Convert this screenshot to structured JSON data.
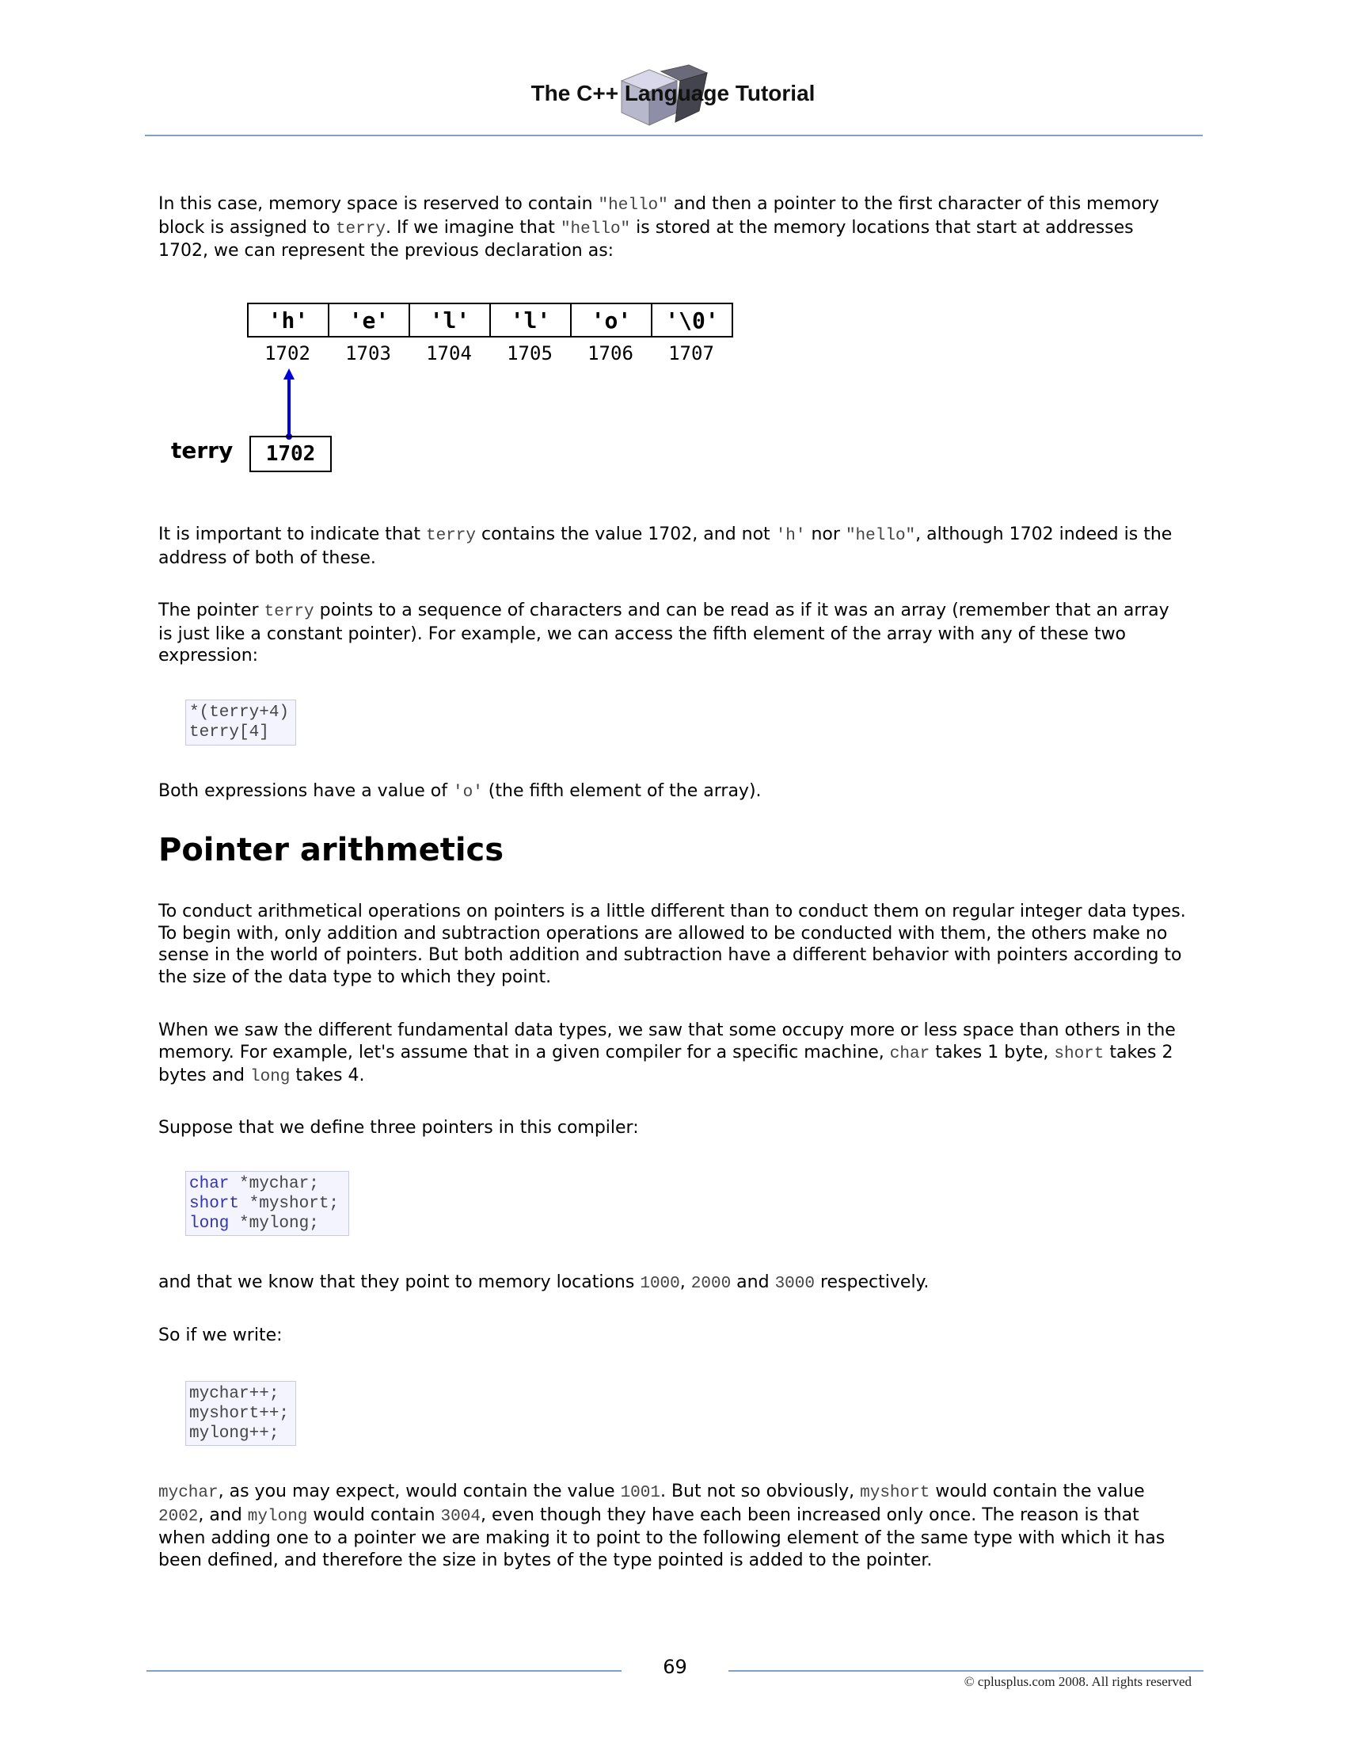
{
  "header": {
    "title": "The C++ Language Tutorial"
  },
  "p1": {
    "a": "In this case, memory space is reserved to contain ",
    "b": "\"hello\"",
    "c": " and then a pointer to the first character of this memory block is assigned to ",
    "d": "terry",
    "e": ". If we imagine that ",
    "f": "\"hello\"",
    "g": " is stored at the memory locations that start at addresses 1702, we can represent the previous declaration as:"
  },
  "diagram": {
    "cells": [
      "'h'",
      "'e'",
      "'l'",
      "'l'",
      "'o'",
      "'\\0'"
    ],
    "addresses": [
      "1702",
      "1703",
      "1704",
      "1705",
      "1706",
      "1707"
    ],
    "pointer_label": "terry",
    "pointer_value": "1702",
    "arrow_color": "#0000dd"
  },
  "p2": {
    "a": "It is important to indicate that ",
    "b": "terry",
    "c": " contains the value 1702, and not ",
    "d": "'h'",
    "e": " nor ",
    "f": "\"hello\"",
    "g": ", although 1702 indeed is the address of both of these."
  },
  "p3": {
    "a": "The pointer ",
    "b": "terry",
    "c": " points to a sequence of characters and can be read as if it was an array (remember that an array is just like a constant pointer). For example, we can access the fifth element of the array with any of these two expression:"
  },
  "code1": [
    "*(terry+4)",
    "terry[4]"
  ],
  "p4": {
    "a": "Both expressions have a value of ",
    "b": "'o'",
    "c": " (the fifth element of the array)."
  },
  "section_heading": "Pointer arithmetics",
  "p5": "To conduct arithmetical operations on pointers is a little different than to conduct them on regular integer data types. To begin with, only addition and subtraction operations are allowed to be conducted with them, the others make no sense in the world of pointers. But both addition and subtraction have a different behavior with pointers according to the size of the data type to which they point.",
  "p6": {
    "a": "When we saw the different fundamental data types, we saw that some occupy more or less space than others in the memory. For example, let's assume that in a given compiler for a specific machine, ",
    "b": "char",
    "c": " takes 1 byte, ",
    "d": "short",
    "e": " takes 2 bytes and ",
    "f": "long",
    "g": " takes 4."
  },
  "p7": "Suppose that we define three pointers in this compiler:",
  "code2": [
    {
      "kw": "char",
      "rest": " *mychar;"
    },
    {
      "kw": "short",
      "rest": " *myshort;"
    },
    {
      "kw": "long",
      "rest": " *mylong;"
    }
  ],
  "p8": {
    "a": "and that we know that they point to memory locations ",
    "b": "1000",
    "c": ", ",
    "d": "2000",
    "e": " and ",
    "f": "3000",
    "g": " respectively."
  },
  "p9": "So if we write:",
  "code3": [
    "mychar++;",
    "myshort++;",
    "mylong++;"
  ],
  "p10": {
    "a": "mychar",
    "b": ", as you may expect, would contain the value ",
    "c": "1001",
    "d": ". But not so obviously, ",
    "e": "myshort",
    "f": " would contain the value ",
    "g": "2002",
    "h": ", and ",
    "i": "mylong",
    "j": " would contain ",
    "k": "3004",
    "l": ", even though they have each been increased only once. The reason is that when adding one to a pointer we are making it to point to the following element of the same type with which it has been defined, and therefore the size in bytes of the type pointed is added to the pointer."
  },
  "footer": {
    "page_number": "69",
    "copyright": "© cplusplus.com 2008. All rights reserved"
  }
}
